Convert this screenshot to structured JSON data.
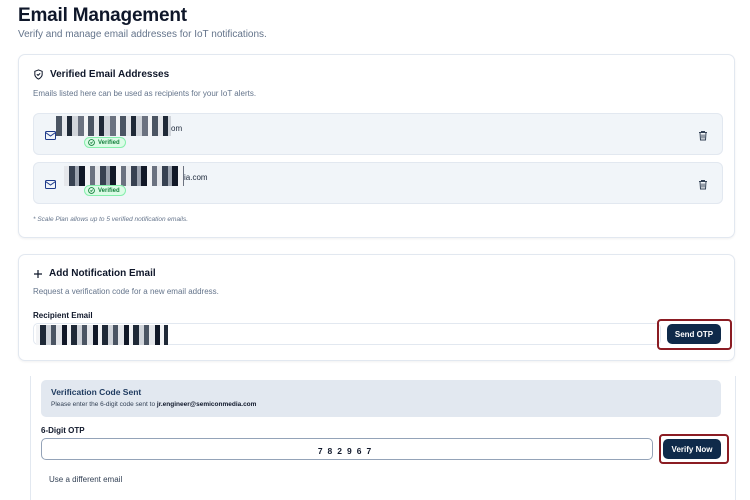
{
  "header": {
    "title": "Email Management",
    "subtitle": "Verify and manage email addresses for IoT notifications."
  },
  "verified": {
    "title": "Verified Email Addresses",
    "description": "Emails listed here can be used as recipients for your IoT alerts.",
    "items": [
      {
        "email_suffix": "om",
        "status": "Verified"
      },
      {
        "email_suffix": "ia.com",
        "status": "Verified"
      }
    ],
    "plan_note": "* Scale Plan allows up to 5 verified notification emails."
  },
  "add_email": {
    "title": "Add Notification Email",
    "description": "Request a verification code for a new email address.",
    "recipient_label": "Recipient Email",
    "send_button": "Send OTP"
  },
  "otp": {
    "sent_title": "Verification Code Sent",
    "sent_prefix": "Please enter the 6-digit code sent to",
    "sent_email": "jr.engineer@semiconmedia.com",
    "label": "6-Digit OTP",
    "value": "782967",
    "verify_button": "Verify Now",
    "different_email_link": "Use a different email"
  },
  "colors": {
    "primary": "#0f2a4a",
    "verified_green": "#15803d",
    "highlight": "#8b1c23"
  }
}
